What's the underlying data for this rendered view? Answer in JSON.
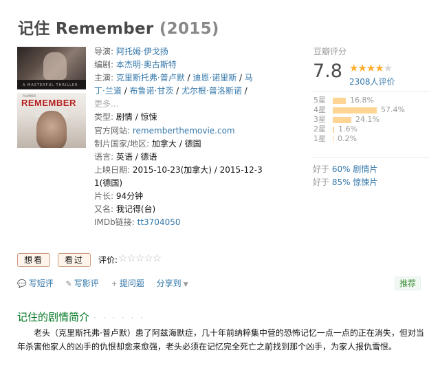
{
  "title": {
    "name": "记住 Remember",
    "year": "(2015)"
  },
  "info": {
    "director_label": "导演:",
    "director": "阿托姆·伊戈扬",
    "writer_label": "编剧:",
    "writer": "本杰明·奥古斯特",
    "cast_label": "主演:",
    "cast": [
      "克里斯托弗·普卢默",
      "迪恩·诺里斯",
      "马丁·兰道",
      "布鲁诺·甘茨",
      "尤尔根·普洛斯诺"
    ],
    "more": "更多...",
    "genre_label": "类型:",
    "genre": "剧情 / 惊悚",
    "site_label": "官方网站:",
    "site": "rememberthemovie.com",
    "country_label": "制片国家/地区:",
    "country": "加拿大 / 德国",
    "lang_label": "语言:",
    "lang": "英语 / 德语",
    "release_label": "上映日期:",
    "release_1": "2015-10-23(加拿大) / 2015-12-3",
    "release_2": "1(德国)",
    "runtime_label": "片长:",
    "runtime": "94分钟",
    "aka_label": "又名:",
    "aka": "我记得(台)",
    "imdb_label": "IMDb链接:",
    "imdb": "tt3704050"
  },
  "rating": {
    "label": "豆瓣评分",
    "score": "7.8",
    "stars": 4,
    "count": "2308人评价",
    "distribution": [
      {
        "label": "5星",
        "pct": "16.8%",
        "value": 16.8
      },
      {
        "label": "4星",
        "pct": "57.4%",
        "value": 57.4
      },
      {
        "label": "3星",
        "pct": "24.1%",
        "value": 24.1
      },
      {
        "label": "2星",
        "pct": "1.6%",
        "value": 1.6
      },
      {
        "label": "1星",
        "pct": "0.2%",
        "value": 0.2
      }
    ],
    "better_1_prefix": "好于",
    "better_1_link": "60% 剧情片",
    "better_2_prefix": "好于",
    "better_2_link": "85% 惊悚片"
  },
  "buttons": {
    "wish": "想看",
    "seen": "看过",
    "rate_label": "评价:"
  },
  "actions": {
    "short_review": "写短评",
    "review": "写影评",
    "question": "提问题",
    "share": "分享到",
    "recommend": "推荐"
  },
  "synopsis": {
    "title": "记住的剧情简介",
    "dots": "· · · · · ·",
    "text": "老头（克里斯托弗·普卢默）患了阿兹海默症，几十年前纳粹集中营的恐怖记忆一点一点的正在消失，但对当年杀害他家人的凶手的仇恨却愈来愈强，老头必须在记忆完全死亡之前找到那个凶手，为家人报仇雪恨。"
  },
  "colors": {
    "accent": "#3377aa",
    "star": "#ffac2d",
    "bar": "#ffd596",
    "green": "#007722"
  }
}
